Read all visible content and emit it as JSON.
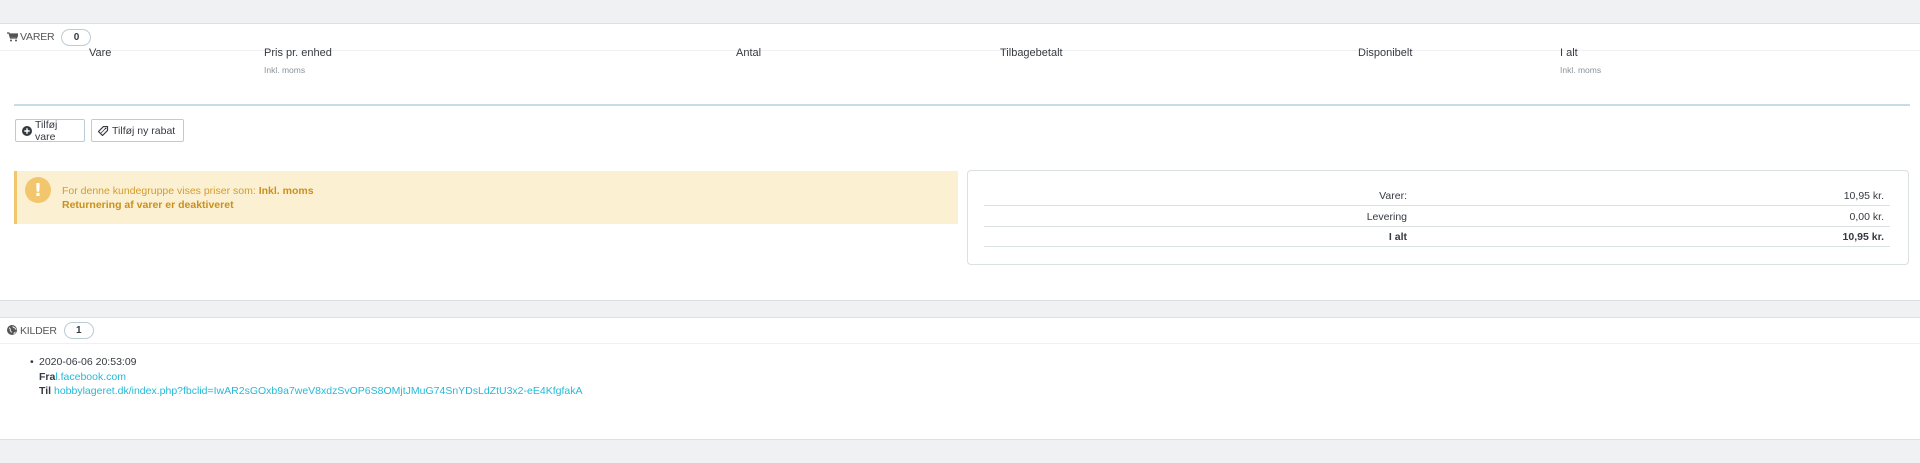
{
  "products_panel": {
    "title": "VARER",
    "count": "0",
    "columns": [
      {
        "label": "Vare",
        "sub": ""
      },
      {
        "label": "Pris pr. enhed",
        "sub": "Inkl. moms"
      },
      {
        "label": "Antal",
        "sub": ""
      },
      {
        "label": "Tilbagebetalt",
        "sub": ""
      },
      {
        "label": "Disponibelt",
        "sub": ""
      },
      {
        "label": "I alt",
        "sub": "Inkl. moms"
      }
    ],
    "add_product_label": "Tilføj vare",
    "add_discount_label": "Tilføj ny rabat",
    "alert": {
      "line1_prefix": "For denne kundegruppe vises priser som: ",
      "line1_bold": "Inkl. moms",
      "line2": "Returnering af varer er deaktiveret"
    },
    "totals": [
      {
        "label": "Varer:",
        "value": "10,95 kr."
      },
      {
        "label": "Levering",
        "value": "0,00 kr."
      },
      {
        "label": "I alt",
        "value": "10,95 kr."
      }
    ]
  },
  "sources_panel": {
    "title": "KILDER",
    "count": "1",
    "entry": {
      "date": "2020-06-06 20:53:09",
      "from_label": "Fra",
      "from_link": "l.facebook.com",
      "to_label": "Til",
      "to_link": "hobbylageret.dk/index.php?fbclid=IwAR2sGOxb9a7weV8xdzSvOP6S8OMjtJMuG74SnYDsLdZtU3x2-eE4KfgfakA"
    }
  },
  "colors": {
    "link": "#25b9d7",
    "warning_bg": "#fcf0d2",
    "warning_accent": "#f2c66d"
  },
  "icons": [
    "cart-icon",
    "plus-circle-icon",
    "tags-icon",
    "exclamation-icon",
    "globe-icon"
  ]
}
